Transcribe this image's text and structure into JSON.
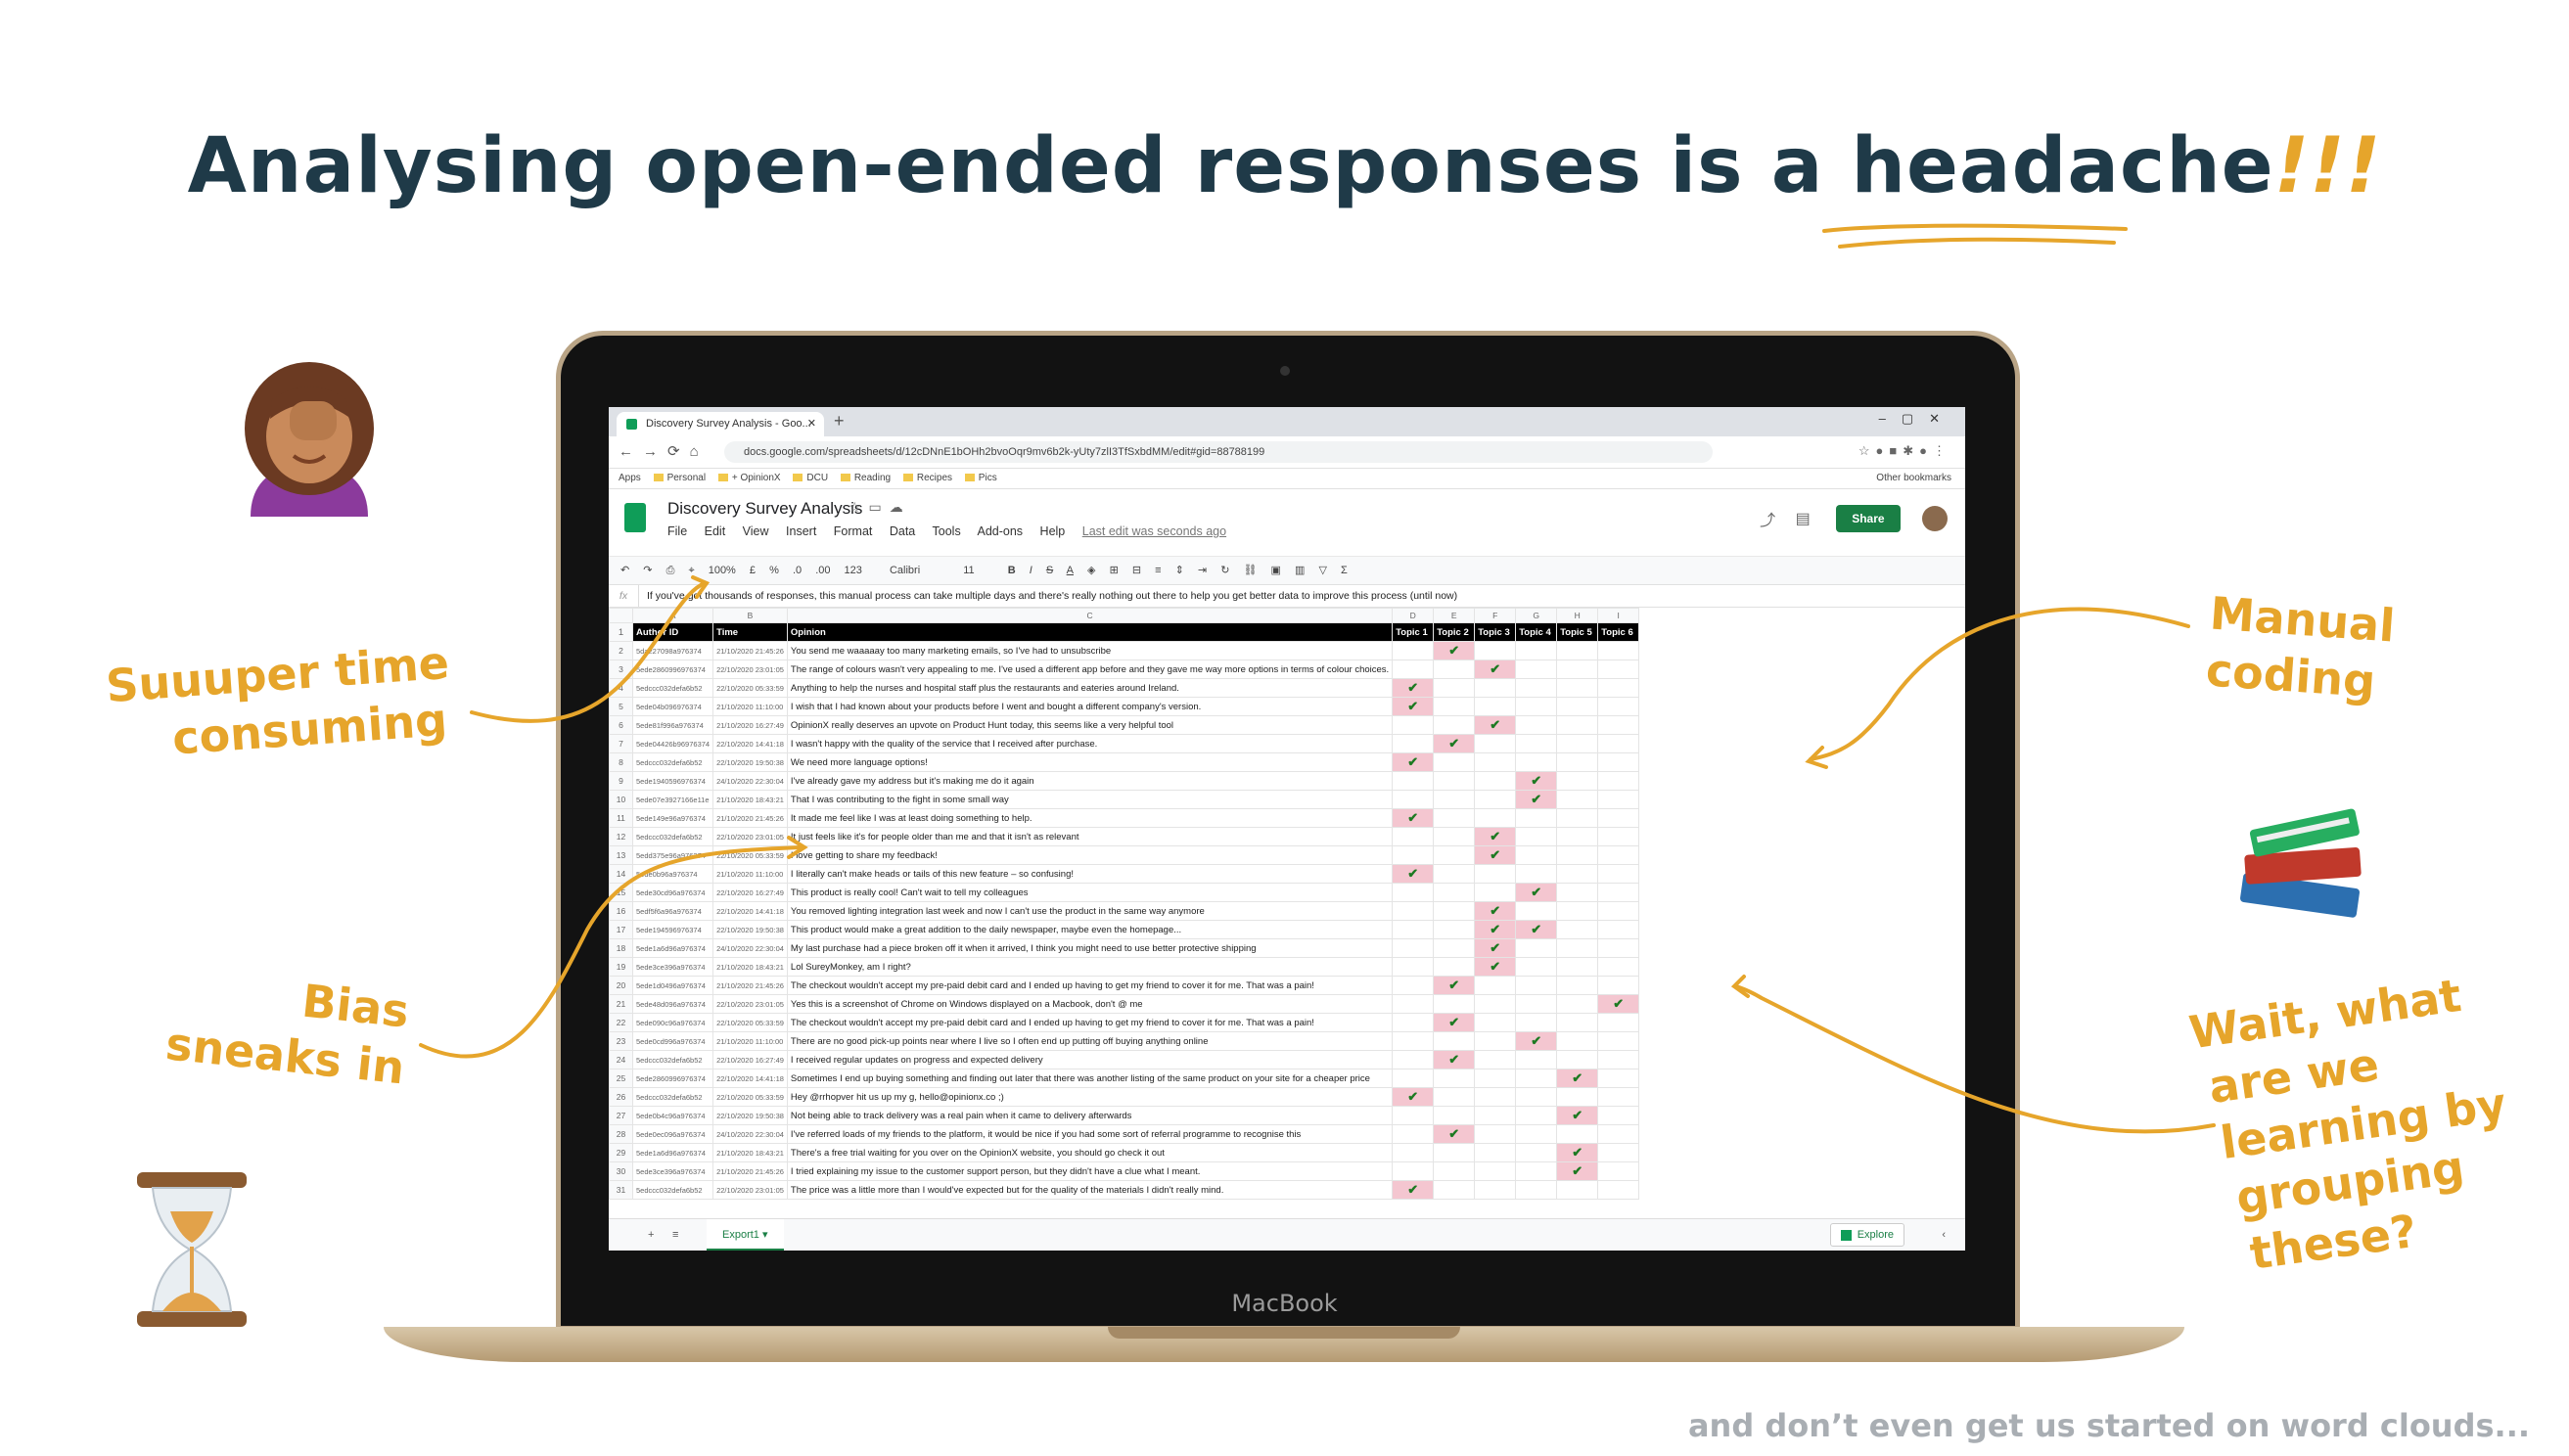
{
  "headline": {
    "main": "Analysing open-ended responses is a",
    "emphasis": "headache",
    "exclaim": "!!!"
  },
  "annotations": {
    "time_l1": "Suuuper time",
    "time_l2": "consuming",
    "bias_l1": "Bias",
    "bias_l2": "sneaks in",
    "manual_l1": "Manual",
    "manual_l2": "coding",
    "wait_l1": "Wait, what",
    "wait_l2": "are we",
    "wait_l3": "learning by",
    "wait_l4": "grouping",
    "wait_l5": "these?"
  },
  "footer": "and don’t even get us started on word clouds...",
  "laptop_brand": "MacBook",
  "browser": {
    "tab_title": "Discovery Survey Analysis - Goo...",
    "url": "docs.google.com/spreadsheets/d/12cDNnE1bOHh2bvoOqr9mv6b2k-yUty7zlI3TfSxbdMM/edit#gid=88788199",
    "bookmarks": [
      "Apps",
      "Personal",
      "+ OpinionX",
      "DCU",
      "Reading",
      "Recipes",
      "Pics"
    ],
    "other_bookmarks": "Other bookmarks"
  },
  "sheet": {
    "doc_title": "Discovery Survey Analysis",
    "menus": [
      "File",
      "Edit",
      "View",
      "Insert",
      "Format",
      "Data",
      "Tools",
      "Add-ons",
      "Help"
    ],
    "last_edit": "Last edit was seconds ago",
    "share_label": "Share",
    "toolbar": {
      "zoom": "100%",
      "currency": "£",
      "percent": "%",
      "decimals": ".0",
      "decimals2": ".00",
      "format": "123",
      "font": "Calibri",
      "size": "11"
    },
    "formula": "If you've got thousands of responses, this manual process can take multiple days and there's really nothing out there to help you get better data to improve this process (until now)",
    "col_letters": [
      "A",
      "B",
      "C",
      "D",
      "E",
      "F",
      "G",
      "H",
      "I"
    ],
    "headers": [
      "Author ID",
      "Time",
      "Opinion",
      "Topic 1",
      "Topic 2",
      "Topic 3",
      "Topic 4",
      "Topic 5",
      "Topic 6"
    ],
    "sheet_tab": "Export1",
    "explore": "Explore",
    "rows": [
      {
        "n": "2",
        "id": "5da227098a976374",
        "time": "21/10/2020 21:45:26",
        "text": "You send me waaaaay too many marketing emails, so I've had to unsubscribe",
        "topics": [
          2
        ]
      },
      {
        "n": "3",
        "id": "5ede2860996976374",
        "time": "22/10/2020 23:01:05",
        "text": "The range of colours wasn't very appealing to me. I've used a different app before and they gave me way more options in terms of colour choices.",
        "topics": [
          3
        ]
      },
      {
        "n": "4",
        "id": "5edccc032defa6b52",
        "time": "22/10/2020 05:33:59",
        "text": "Anything to help the nurses and hospital staff plus the restaurants and eateries around Ireland.",
        "topics": [
          1
        ]
      },
      {
        "n": "5",
        "id": "5ede04b096976374",
        "time": "21/10/2020 11:10:00",
        "text": "I wish that I had known about your products before I went and bought a different company's version.",
        "topics": [
          1
        ]
      },
      {
        "n": "6",
        "id": "5ede81f996a976374",
        "time": "21/10/2020 16:27:49",
        "text": "OpinionX really deserves an upvote on Product Hunt today, this seems like a very helpful tool",
        "topics": [
          3
        ]
      },
      {
        "n": "7",
        "id": "5ede04426b96976374",
        "time": "22/10/2020 14:41:18",
        "text": "I wasn't happy with the quality of the service that I received after purchase.",
        "topics": [
          2
        ]
      },
      {
        "n": "8",
        "id": "5edccc032defa6b52",
        "time": "22/10/2020 19:50:38",
        "text": "We need more language options!",
        "topics": [
          1
        ]
      },
      {
        "n": "9",
        "id": "5ede1940596976374",
        "time": "24/10/2020 22:30:04",
        "text": "I've already gave my address but it's making me do it again",
        "topics": [
          4
        ]
      },
      {
        "n": "10",
        "id": "5ede07e3927166e11e",
        "time": "21/10/2020 18:43:21",
        "text": "That I was contributing to the fight in some small way",
        "topics": [
          4
        ]
      },
      {
        "n": "11",
        "id": "5ede149e96a976374",
        "time": "21/10/2020 21:45:26",
        "text": "It made me feel like I was at least doing something to help.",
        "topics": [
          1
        ]
      },
      {
        "n": "12",
        "id": "5edccc032defa6b52",
        "time": "22/10/2020 23:01:05",
        "text": "It just feels like it's for people older than me and that it isn't as relevant",
        "topics": [
          3
        ]
      },
      {
        "n": "13",
        "id": "5edd375e96a976374",
        "time": "22/10/2020 05:33:59",
        "text": "I love getting to share my feedback!",
        "topics": [
          3
        ]
      },
      {
        "n": "14",
        "id": "5ede0b96a976374",
        "time": "21/10/2020 11:10:00",
        "text": "I literally can't make heads or tails of this new feature – so confusing!",
        "topics": [
          1
        ]
      },
      {
        "n": "15",
        "id": "5ede30cd96a976374",
        "time": "22/10/2020 16:27:49",
        "text": "This product is really cool! Can't wait to tell my colleagues",
        "topics": [
          4
        ]
      },
      {
        "n": "16",
        "id": "5edf5f6a96a976374",
        "time": "22/10/2020 14:41:18",
        "text": "You removed lighting integration last week and now I can't use the product in the same way anymore",
        "topics": [
          3
        ]
      },
      {
        "n": "17",
        "id": "5ede194596976374",
        "time": "22/10/2020 19:50:38",
        "text": "This product would make a great addition to the daily newspaper, maybe even the homepage...",
        "topics": [
          3,
          4
        ]
      },
      {
        "n": "18",
        "id": "5ede1a6d96a976374",
        "time": "24/10/2020 22:30:04",
        "text": "My last purchase had a piece broken off it when it arrived, I think you might need to use better protective shipping",
        "topics": [
          3
        ]
      },
      {
        "n": "19",
        "id": "5ede3ce396a976374",
        "time": "21/10/2020 18:43:21",
        "text": "Lol SureyMonkey, am I right?",
        "topics": [
          3
        ]
      },
      {
        "n": "20",
        "id": "5ede1d0496a976374",
        "time": "21/10/2020 21:45:26",
        "text": "The checkout wouldn't accept my pre-paid debit card and I ended up having to get my friend to cover it for me. That was a pain!",
        "topics": [
          2
        ]
      },
      {
        "n": "21",
        "id": "5ede48d096a976374",
        "time": "22/10/2020 23:01:05",
        "text": "Yes this is a screenshot of Chrome on Windows displayed on a Macbook, don't @ me",
        "topics": [
          6
        ]
      },
      {
        "n": "22",
        "id": "5ede090c96a976374",
        "time": "22/10/2020 05:33:59",
        "text": "The checkout wouldn't accept my pre-paid debit card and I ended up having to get my friend to cover it for me. That was a pain!",
        "topics": [
          2
        ]
      },
      {
        "n": "23",
        "id": "5ede0cd996a976374",
        "time": "21/10/2020 11:10:00",
        "text": "There are no good pick-up points near where I live so I often end up putting off buying anything online",
        "topics": [
          4
        ]
      },
      {
        "n": "24",
        "id": "5edccc032defa6b52",
        "time": "22/10/2020 16:27:49",
        "text": "I received regular updates on progress and expected delivery",
        "topics": [
          2
        ]
      },
      {
        "n": "25",
        "id": "5ede2860996976374",
        "time": "22/10/2020 14:41:18",
        "text": "Sometimes I end up buying something and finding out later that there was another listing of the same product on your site for a cheaper price",
        "topics": [
          5
        ]
      },
      {
        "n": "26",
        "id": "5edccc032defa6b52",
        "time": "22/10/2020 05:33:59",
        "text": "Hey @rrhopver hit us up my g, hello@opinionx.co ;)",
        "topics": [
          1
        ]
      },
      {
        "n": "27",
        "id": "5ede0b4c96a976374",
        "time": "22/10/2020 19:50:38",
        "text": "Not being able to track delivery was a real pain when it came to delivery afterwards",
        "topics": [
          5
        ]
      },
      {
        "n": "28",
        "id": "5ede0ec096a976374",
        "time": "24/10/2020 22:30:04",
        "text": "I've referred loads of my friends to the platform, it would be nice if you had some sort of referral programme to recognise this",
        "topics": [
          2
        ]
      },
      {
        "n": "29",
        "id": "5ede1a6d96a976374",
        "time": "21/10/2020 18:43:21",
        "text": "There's a free trial waiting for you over on the OpinionX website, you should go check it out",
        "topics": [
          5
        ]
      },
      {
        "n": "30",
        "id": "5ede3ce396a976374",
        "time": "21/10/2020 21:45:26",
        "text": "I tried explaining my issue to the customer support person, but they didn't have a clue what I meant.",
        "topics": [
          5
        ]
      },
      {
        "n": "31",
        "id": "5edccc032defa6b52",
        "time": "22/10/2020 23:01:05",
        "text": "The price was a little more than I would've expected but for the quality of the materials I didn't really mind.",
        "topics": [
          1
        ]
      }
    ]
  },
  "colors": {
    "headline": "#1f3a48",
    "accent": "#e6a52b",
    "check": "#1d7a22",
    "tick_bg": "#f4c6d0",
    "share": "#1a7f45"
  }
}
